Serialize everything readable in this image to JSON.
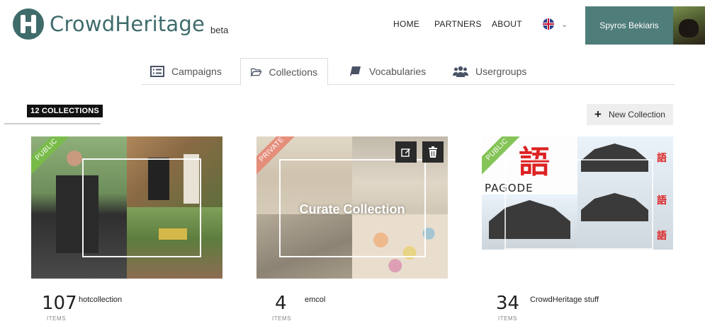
{
  "header": {
    "logo_text": "CrowdHeritage",
    "logo_badge": "beta",
    "nav": [
      {
        "label": "HOME"
      },
      {
        "label": "PARTNERS"
      },
      {
        "label": "ABOUT"
      }
    ],
    "language_icon": "uk-flag-icon",
    "user_name": "Spyros Bekiaris"
  },
  "tabs": [
    {
      "label": "Campaigns",
      "icon": "list-icon",
      "active": false
    },
    {
      "label": "Collections",
      "icon": "folder-open-icon",
      "active": true
    },
    {
      "label": "Vocabularies",
      "icon": "book-icon",
      "active": false
    },
    {
      "label": "Usergroups",
      "icon": "users-icon",
      "active": false
    }
  ],
  "section": {
    "count_label": "12 COLLECTIONS",
    "new_button_label": "New Collection"
  },
  "collections": [
    {
      "title": "hotcollection",
      "items": "107",
      "items_label": "ITEMS",
      "visibility": "PUBLIC"
    },
    {
      "title": "emcol",
      "items": "4",
      "items_label": "ITEMS",
      "visibility": "PRIVATE",
      "hover_label": "Curate Collection"
    },
    {
      "title": "CrowdHeritage stuff",
      "items": "34",
      "items_label": "ITEMS",
      "visibility": "PUBLIC",
      "image_caption": "PAGODE"
    }
  ],
  "colors": {
    "brand": "#3f6b6b",
    "user_bg": "#4f7d7a",
    "public_ribbon": "#78be46",
    "private_ribbon": "#e6826e"
  }
}
